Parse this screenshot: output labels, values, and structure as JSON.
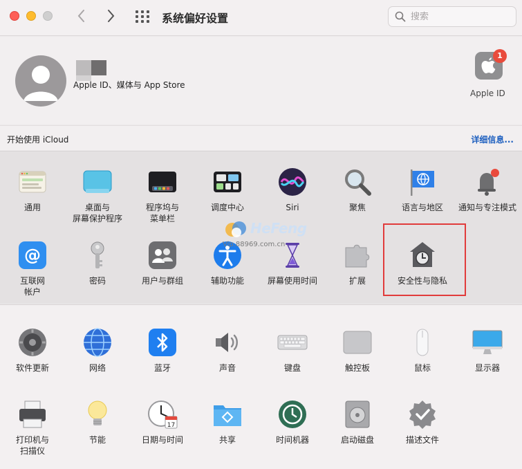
{
  "window": {
    "title": "系统偏好设置",
    "search_placeholder": "搜索"
  },
  "account": {
    "subtitle": "Apple ID、媒体与 App Store",
    "apple_id_label": "Apple ID",
    "badge_count": "1"
  },
  "icloud": {
    "prompt": "开始使用 iCloud",
    "details_link": "详细信息..."
  },
  "section1": [
    {
      "label": "通用",
      "icon": "general-icon"
    },
    {
      "label": "桌面与\n屏幕保护程序",
      "icon": "desktop-screensaver-icon"
    },
    {
      "label": "程序坞与\n菜单栏",
      "icon": "dock-menubar-icon"
    },
    {
      "label": "调度中心",
      "icon": "mission-control-icon"
    },
    {
      "label": "Siri",
      "icon": "siri-icon"
    },
    {
      "label": "聚焦",
      "icon": "spotlight-icon"
    },
    {
      "label": "语言与地区",
      "icon": "language-region-icon"
    },
    {
      "label": "通知与专注模式",
      "icon": "notifications-icon"
    },
    {
      "label": "互联网\n帐户",
      "icon": "internet-accounts-icon"
    },
    {
      "label": "密码",
      "icon": "passwords-icon"
    },
    {
      "label": "用户与群组",
      "icon": "users-groups-icon"
    },
    {
      "label": "辅助功能",
      "icon": "accessibility-icon"
    },
    {
      "label": "屏幕使用时间",
      "icon": "screen-time-icon"
    },
    {
      "label": "扩展",
      "icon": "extensions-icon"
    },
    {
      "label": "安全性与隐私",
      "icon": "security-privacy-icon"
    }
  ],
  "section2": [
    {
      "label": "软件更新",
      "icon": "software-update-icon"
    },
    {
      "label": "网络",
      "icon": "network-icon"
    },
    {
      "label": "蓝牙",
      "icon": "bluetooth-icon"
    },
    {
      "label": "声音",
      "icon": "sound-icon"
    },
    {
      "label": "键盘",
      "icon": "keyboard-icon"
    },
    {
      "label": "触控板",
      "icon": "trackpad-icon"
    },
    {
      "label": "鼠标",
      "icon": "mouse-icon"
    },
    {
      "label": "显示器",
      "icon": "displays-icon"
    },
    {
      "label": "打印机与\n扫描仪",
      "icon": "printers-scanners-icon"
    },
    {
      "label": "节能",
      "icon": "energy-saver-icon"
    },
    {
      "label": "日期与时间",
      "icon": "date-time-icon"
    },
    {
      "label": "共享",
      "icon": "sharing-icon"
    },
    {
      "label": "时间机器",
      "icon": "time-machine-icon"
    },
    {
      "label": "启动磁盘",
      "icon": "startup-disk-icon"
    },
    {
      "label": "描述文件",
      "icon": "profiles-icon"
    }
  ],
  "date_tile_day": "17",
  "watermark": {
    "title": "HeFeng",
    "subtitle": "Vip.88969.com.cn"
  },
  "colors": {
    "link": "#1d5fbf",
    "highlight": "#e13b3b",
    "badge": "#e94b3c"
  }
}
